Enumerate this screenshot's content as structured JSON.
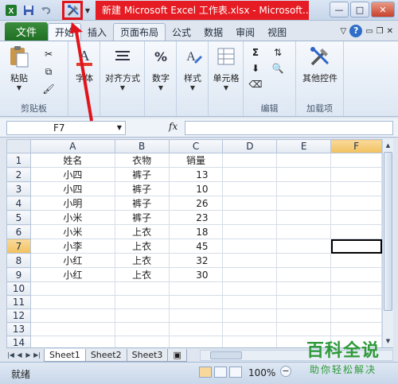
{
  "window": {
    "title": "新建 Microsoft Excel 工作表.xlsx - Microsoft...",
    "minimize": "—",
    "maximize": "□",
    "close": "✕"
  },
  "ribbon": {
    "file_tab": "文件",
    "tabs": [
      "开始",
      "插入",
      "页面布局",
      "公式",
      "数据",
      "审阅",
      "视图"
    ],
    "groups": {
      "clipboard": {
        "label": "剪贴板",
        "paste": "粘贴"
      },
      "font": {
        "label": "字体"
      },
      "alignment": {
        "label": "对齐方式"
      },
      "number": {
        "label": "数字"
      },
      "styles": {
        "label": "样式"
      },
      "cells": {
        "label": "单元格"
      },
      "editing": {
        "label": "编辑"
      },
      "addins": {
        "label": "加载项",
        "other": "其他控件"
      }
    }
  },
  "formula_bar": {
    "name_box": "F7",
    "fx": "fx",
    "formula": ""
  },
  "grid": {
    "columns": [
      "A",
      "B",
      "C",
      "D",
      "E",
      "F"
    ],
    "selected_column": "F",
    "selected_row": "7",
    "rows": [
      [
        "姓名",
        "衣物",
        "销量"
      ],
      [
        "小四",
        "裤子",
        "13"
      ],
      [
        "小四",
        "裤子",
        "10"
      ],
      [
        "小明",
        "裤子",
        "26"
      ],
      [
        "小米",
        "裤子",
        "23"
      ],
      [
        "小米",
        "上衣",
        "18"
      ],
      [
        "小李",
        "上衣",
        "45"
      ],
      [
        "小红",
        "上衣",
        "32"
      ],
      [
        "小红",
        "上衣",
        "30"
      ]
    ],
    "row_count": 15
  },
  "sheets": [
    "Sheet1",
    "Sheet2",
    "Sheet3"
  ],
  "active_sheet": "Sheet1",
  "status": {
    "ready": "就绪",
    "zoom": "100%"
  },
  "watermark": {
    "line1": "百科全说",
    "line2": "助你轻松解决"
  },
  "colors": {
    "title_highlight": "#e51c23",
    "file_tab": "#1f6f22",
    "annotation_red": "#e0141a",
    "watermark": "#2f9a3a"
  }
}
